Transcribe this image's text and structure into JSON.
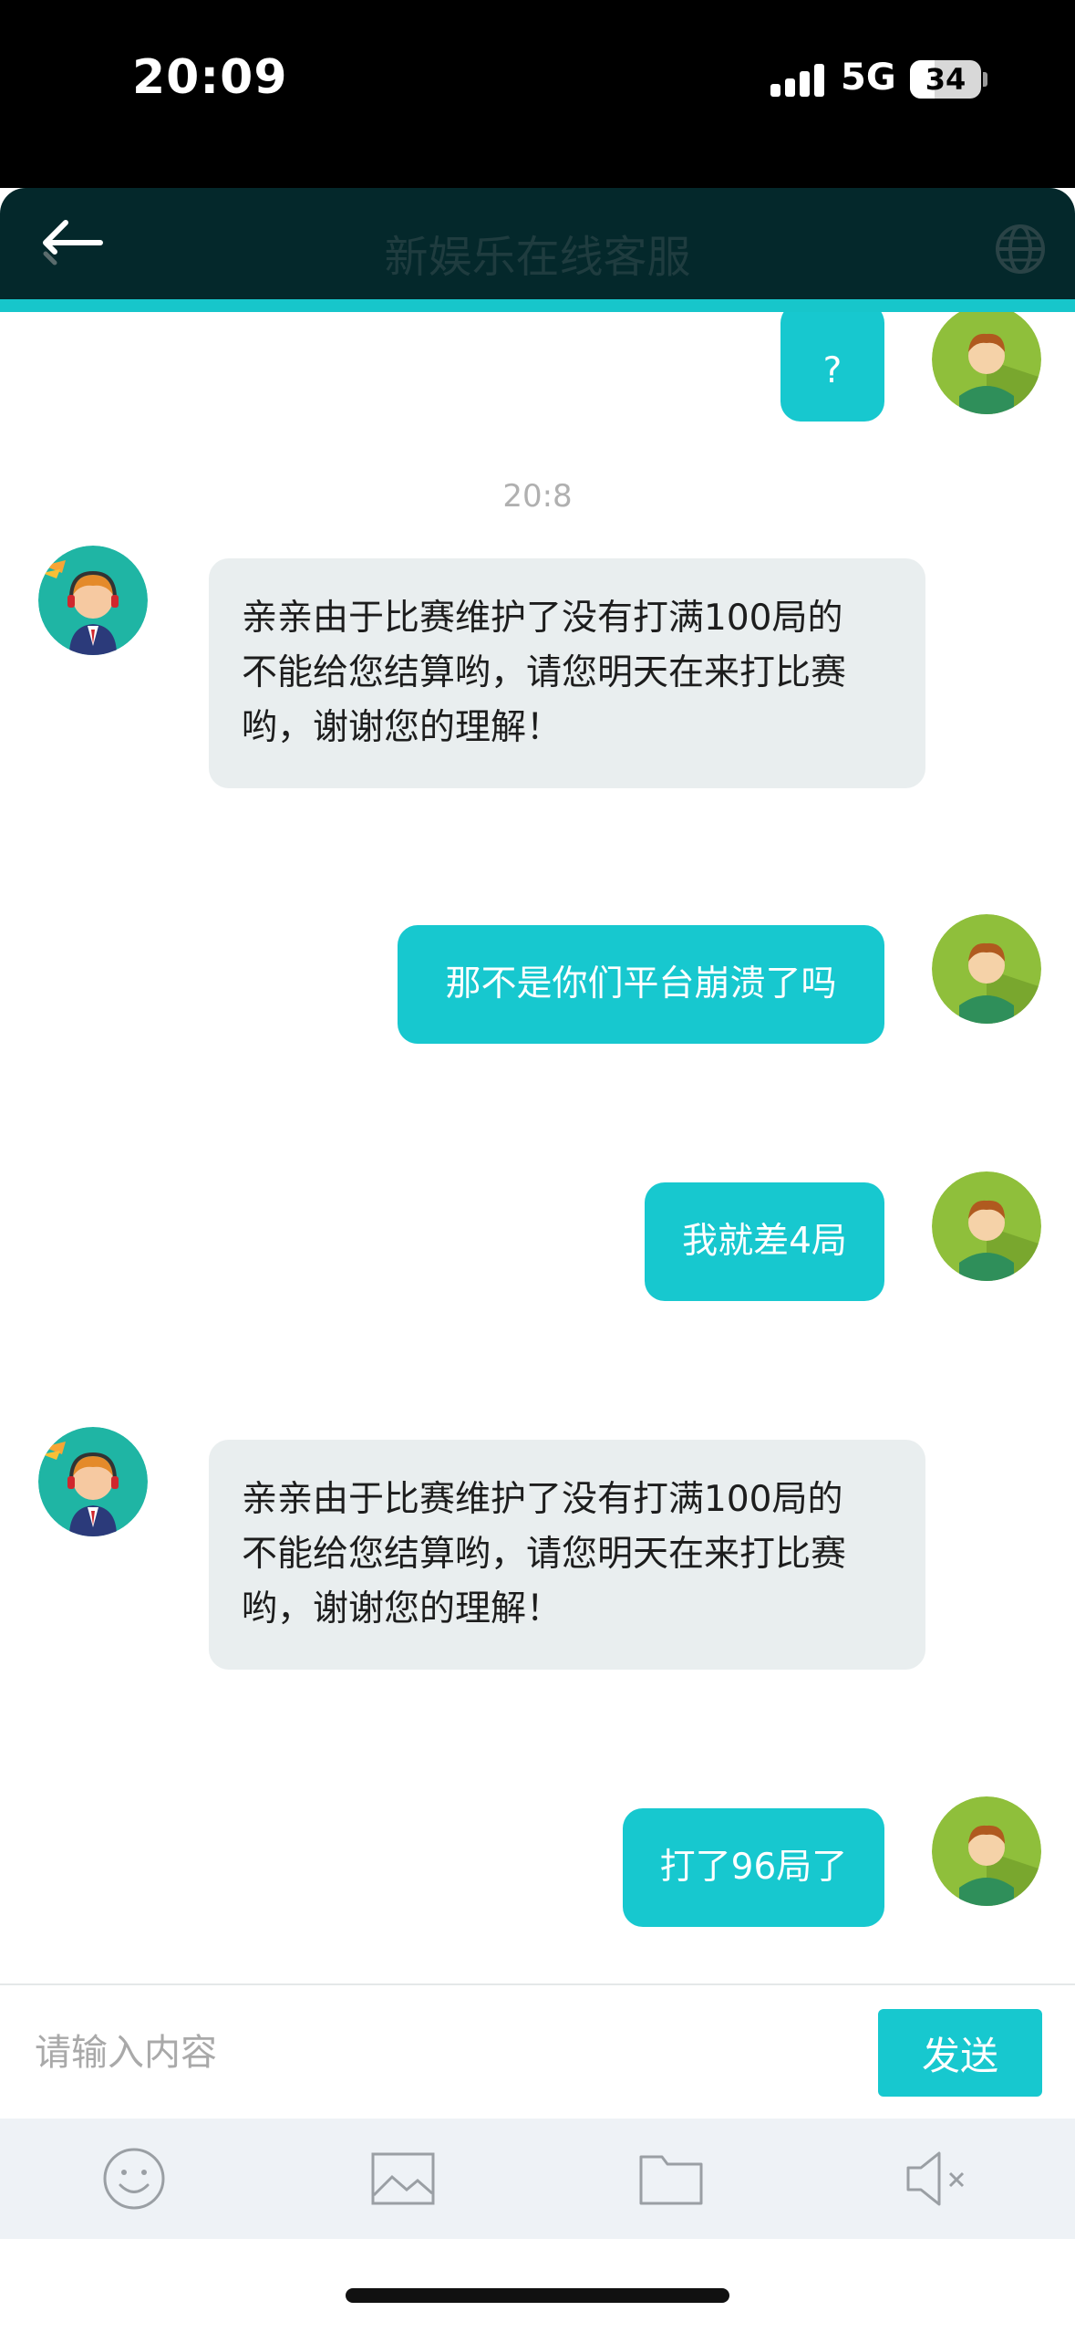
{
  "status_bar": {
    "time": "20:09",
    "network": "5G",
    "battery": "34",
    "battery_level": 0.34
  },
  "header": {
    "title": "新娱乐在线客服",
    "back_icon": "arrow-left-icon",
    "globe_icon": "globe-icon"
  },
  "chat": {
    "messages": [
      {
        "from": "user",
        "text": "?"
      },
      {
        "from": "system-time",
        "text": "20:8"
      },
      {
        "from": "agent",
        "lines": [
          "亲亲由于比赛维护了没有打满100局的",
          "不能给您结算哟，请您明天在来打比赛",
          "哟，谢谢您的理解！"
        ]
      },
      {
        "from": "user",
        "text": "那不是你们平台崩溃了吗"
      },
      {
        "from": "user",
        "text": "我就差4局"
      },
      {
        "from": "agent",
        "lines": [
          "亲亲由于比赛维护了没有打满100局的",
          "不能给您结算哟，请您明天在来打比赛",
          "哟，谢谢您的理解！"
        ]
      },
      {
        "from": "user",
        "text": "打了96局了"
      }
    ]
  },
  "input": {
    "placeholder": "请输入内容",
    "send_label": "发送"
  },
  "toolbar": {
    "icons": [
      "smiley-icon",
      "image-icon",
      "folder-icon",
      "speaker-muted-icon"
    ]
  },
  "colors": {
    "accent": "#17c8cf",
    "header_bg": "#04282b",
    "agent_bubble": "#e9eeef"
  }
}
